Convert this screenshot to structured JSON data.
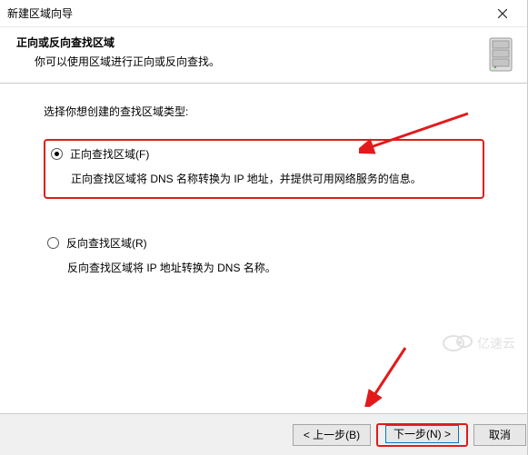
{
  "titlebar": {
    "title": "新建区域向导"
  },
  "header": {
    "heading": "正向或反向查找区域",
    "sub": "你可以使用区域进行正向或反向查找。"
  },
  "content": {
    "prompt": "选择你想创建的查找区域类型:",
    "option1": {
      "label": "正向查找区域(F)",
      "desc": "正向查找区域将 DNS 名称转换为 IP 地址，并提供可用网络服务的信息。"
    },
    "option2": {
      "label": "反向查找区域(R)",
      "desc": "反向查找区域将 IP 地址转换为 DNS 名称。"
    }
  },
  "footer": {
    "back": "< 上一步(B)",
    "next": "下一步(N) >",
    "cancel": "取消"
  },
  "watermark": {
    "text": "亿速云"
  },
  "annotations": {
    "highlight": "option1",
    "highlight_button": "next",
    "arrows": [
      "to-option1",
      "to-next-button"
    ]
  }
}
